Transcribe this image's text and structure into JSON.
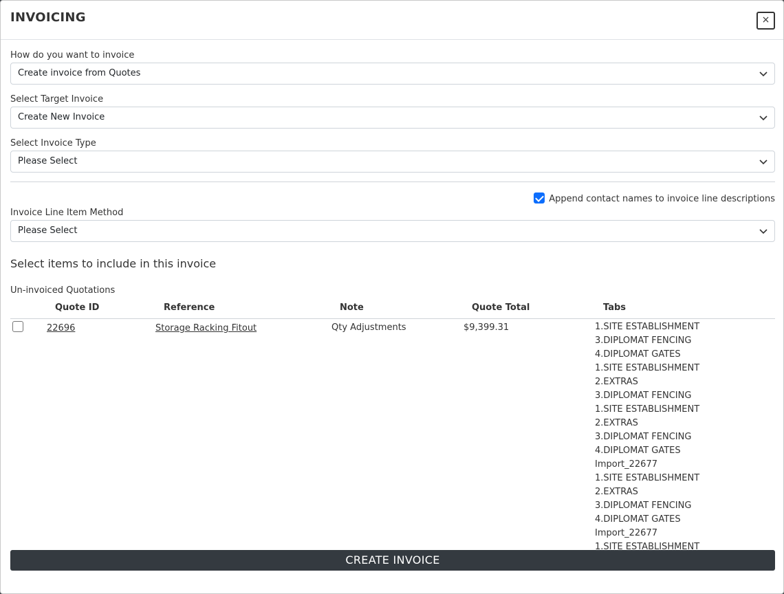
{
  "modal": {
    "title": "INVOICING",
    "close_label": "×"
  },
  "form": {
    "invoice_method": {
      "label": "How do you want to invoice",
      "value": "Create invoice from Quotes"
    },
    "target_invoice": {
      "label": "Select Target Invoice",
      "value": "Create New Invoice"
    },
    "invoice_type": {
      "label": "Select Invoice Type",
      "value": "Please Select"
    },
    "append_contacts": {
      "label": "Append contact names to invoice line descriptions",
      "checked": true
    },
    "line_item_method": {
      "label": "Invoice Line Item Method",
      "value": "Please Select"
    }
  },
  "items_section": {
    "title": "Select items to include in this invoice",
    "subtitle": "Un-invoiced Quotations",
    "columns": [
      "Quote ID",
      "Reference",
      "Note",
      "Quote Total",
      "Tabs"
    ],
    "rows": [
      {
        "checked": false,
        "quote_id": "22696",
        "reference": "Storage Racking Fitout",
        "note": "Qty Adjustments",
        "quote_total": "$9,399.31",
        "tabs": [
          "1.SITE ESTABLISHMENT",
          "3.DIPLOMAT FENCING",
          "4.DIPLOMAT GATES",
          "1.SITE ESTABLISHMENT",
          "2.EXTRAS",
          "3.DIPLOMAT FENCING",
          "1.SITE ESTABLISHMENT",
          "2.EXTRAS",
          "3.DIPLOMAT FENCING",
          "4.DIPLOMAT GATES",
          "Import_22677",
          "1.SITE ESTABLISHMENT",
          "2.EXTRAS",
          "3.DIPLOMAT FENCING",
          "4.DIPLOMAT GATES",
          "Import_22677",
          "1.SITE ESTABLISHMENT"
        ]
      }
    ]
  },
  "footer": {
    "create_label": "CREATE INVOICE"
  }
}
